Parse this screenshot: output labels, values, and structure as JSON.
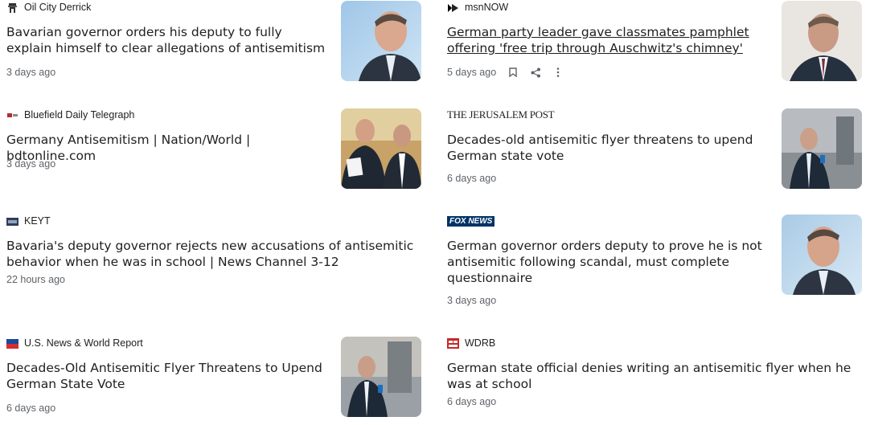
{
  "articles": [
    {
      "source": "Oil City Derrick",
      "title": "Bavarian governor orders his deputy to fully explain himself to clear allegations of antisemitism",
      "time": "3 days ago",
      "thumb_icon": "governor-portrait-image"
    },
    {
      "source": "msnNOW",
      "title": "German party leader gave classmates pamphlet offering 'free trip through Auschwitz's chimney'",
      "time": "5 days ago",
      "thumb_icon": "deputy-portrait-image"
    },
    {
      "source": "Bluefield Daily Telegraph",
      "title": "Germany Antisemitism | Nation/World | bdtonline.com",
      "time": "3 days ago",
      "thumb_icon": "two-politicians-image"
    },
    {
      "source": "THE JERUSALEM POST",
      "title": "Decades-old antisemitic flyer threatens to upend German state vote",
      "time": "6 days ago",
      "thumb_icon": "deputy-press-image"
    },
    {
      "source": "KEYT",
      "title": "Bavaria's deputy governor rejects new accusations of antisemitic behavior when he was in school | News Channel 3-12",
      "time": "22 hours ago"
    },
    {
      "source": "FOX NEWS",
      "title": "German governor orders deputy to prove he is not antisemitic following scandal, must complete questionnaire",
      "time": "3 days ago",
      "thumb_icon": "governor-portrait-image"
    },
    {
      "source": "U.S. News & World Report",
      "title": "Decades-Old Antisemitic Flyer Threatens to Upend German State Vote",
      "time": "6 days ago",
      "thumb_icon": "deputy-press-image"
    },
    {
      "source": "WDRB",
      "title": "German state official denies writing an antisemitic flyer when he was at school",
      "time": "6 days ago"
    }
  ],
  "actions": {
    "save_icon": "bookmark-icon",
    "share_icon": "share-icon",
    "more_icon": "more-vert-icon"
  },
  "colors": {
    "title": "#1f1f1f",
    "meta": "#5f6368",
    "fox": "#003366",
    "usnews": "#d32f2f",
    "wdrb": "#c62828"
  }
}
